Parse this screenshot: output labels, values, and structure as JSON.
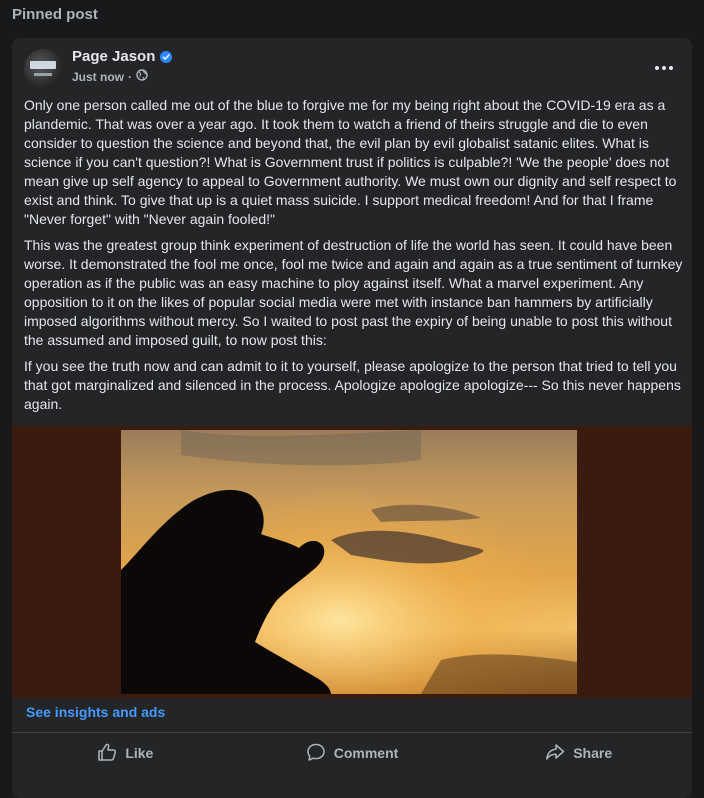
{
  "section": {
    "label": "Pinned post"
  },
  "post": {
    "author": "Page Jason",
    "verified": true,
    "timestamp": "Just now",
    "separator": "·",
    "privacy_icon": "globe-icon",
    "paragraphs": [
      "Only one person called me out of the blue to forgive me for my being right about the COVID-19 era as a plandemic. That was over a year ago. It took them to watch a friend of theirs struggle and die to even consider to question the science and beyond that, the evil plan by evil globalist satanic elites. What is science if you can't question?! What is Government trust if politics is culpable?! 'We the people' does not mean give up self agency to appeal to Government authority. We must own our dignity and self respect to exist and think. To give that up is a quiet mass suicide. I support medical freedom! And for that I frame \"Never forget\" with \"Never again fooled!\"",
      "This was the greatest group think experiment of destruction of life the world has seen. It could have been worse. It demonstrated the fool me once, fool me twice and again and again as a true sentiment of turnkey operation as if the public was an easy machine to ploy against itself. What a marvel experiment. Any opposition to it on the likes of popular social media were met with instance ban hammers by artificially imposed algorithms without mercy. So I waited to post past the expiry of being unable to post this without the assumed and imposed guilt, to now post this:",
      "If you see the truth now and can admit to it to yourself, please apologize to the person that tried to tell you that got marginalized and silenced in the process. Apologize apologize apologize--- So this never happens again."
    ],
    "image_subject": "silhouette of kneeling praying person against sunset sky",
    "insights_link": "See insights and ads",
    "actions": {
      "like": "Like",
      "comment": "Comment",
      "share": "Share"
    }
  },
  "colors": {
    "background": "#18191a",
    "card": "#242526",
    "link": "#4599ff",
    "verified": "#2d88ff"
  }
}
